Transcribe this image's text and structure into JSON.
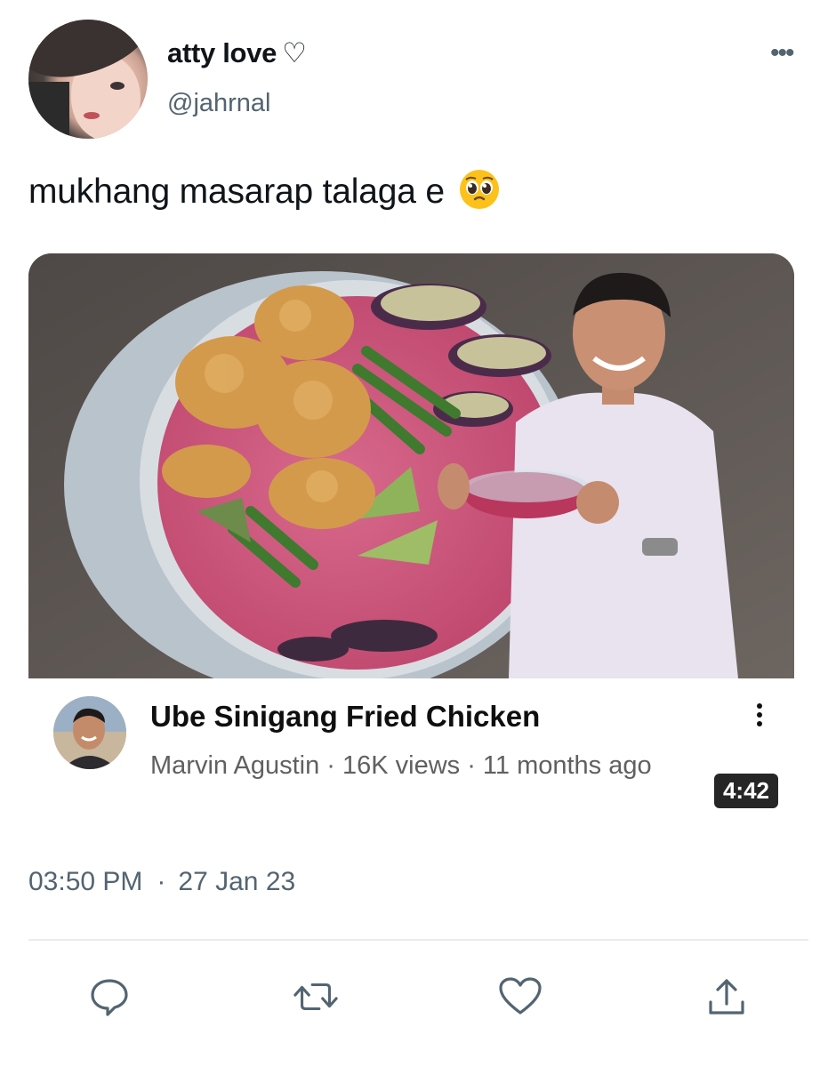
{
  "tweet": {
    "display_name": "atty love",
    "name_suffix_icon": "heart-outline-icon",
    "name_suffix": "♡",
    "handle": "@jahrnal",
    "more_icon": "more-horizontal-icon",
    "more_label": "•••",
    "text": "mukhang masarap talaga e",
    "emoji": "pleading-face-emoji",
    "time": "03:50 PM",
    "separator": "·",
    "date": "27 Jan 23"
  },
  "video_card": {
    "duration": "4:42",
    "title": "Ube Sinigang Fried Chicken",
    "meta": "Marvin Agustin · 16K views · 11 months ago",
    "menu_icon": "kebab-menu-icon"
  },
  "actions": [
    {
      "name": "reply",
      "icon": "reply-bubble-icon"
    },
    {
      "name": "retweet",
      "icon": "retweet-icon"
    },
    {
      "name": "like",
      "icon": "heart-icon"
    },
    {
      "name": "share",
      "icon": "share-upload-icon"
    }
  ],
  "colors": {
    "text_primary": "#0f1419",
    "text_secondary": "#536471",
    "divider": "#e6ecf0",
    "icon": "#536471"
  }
}
